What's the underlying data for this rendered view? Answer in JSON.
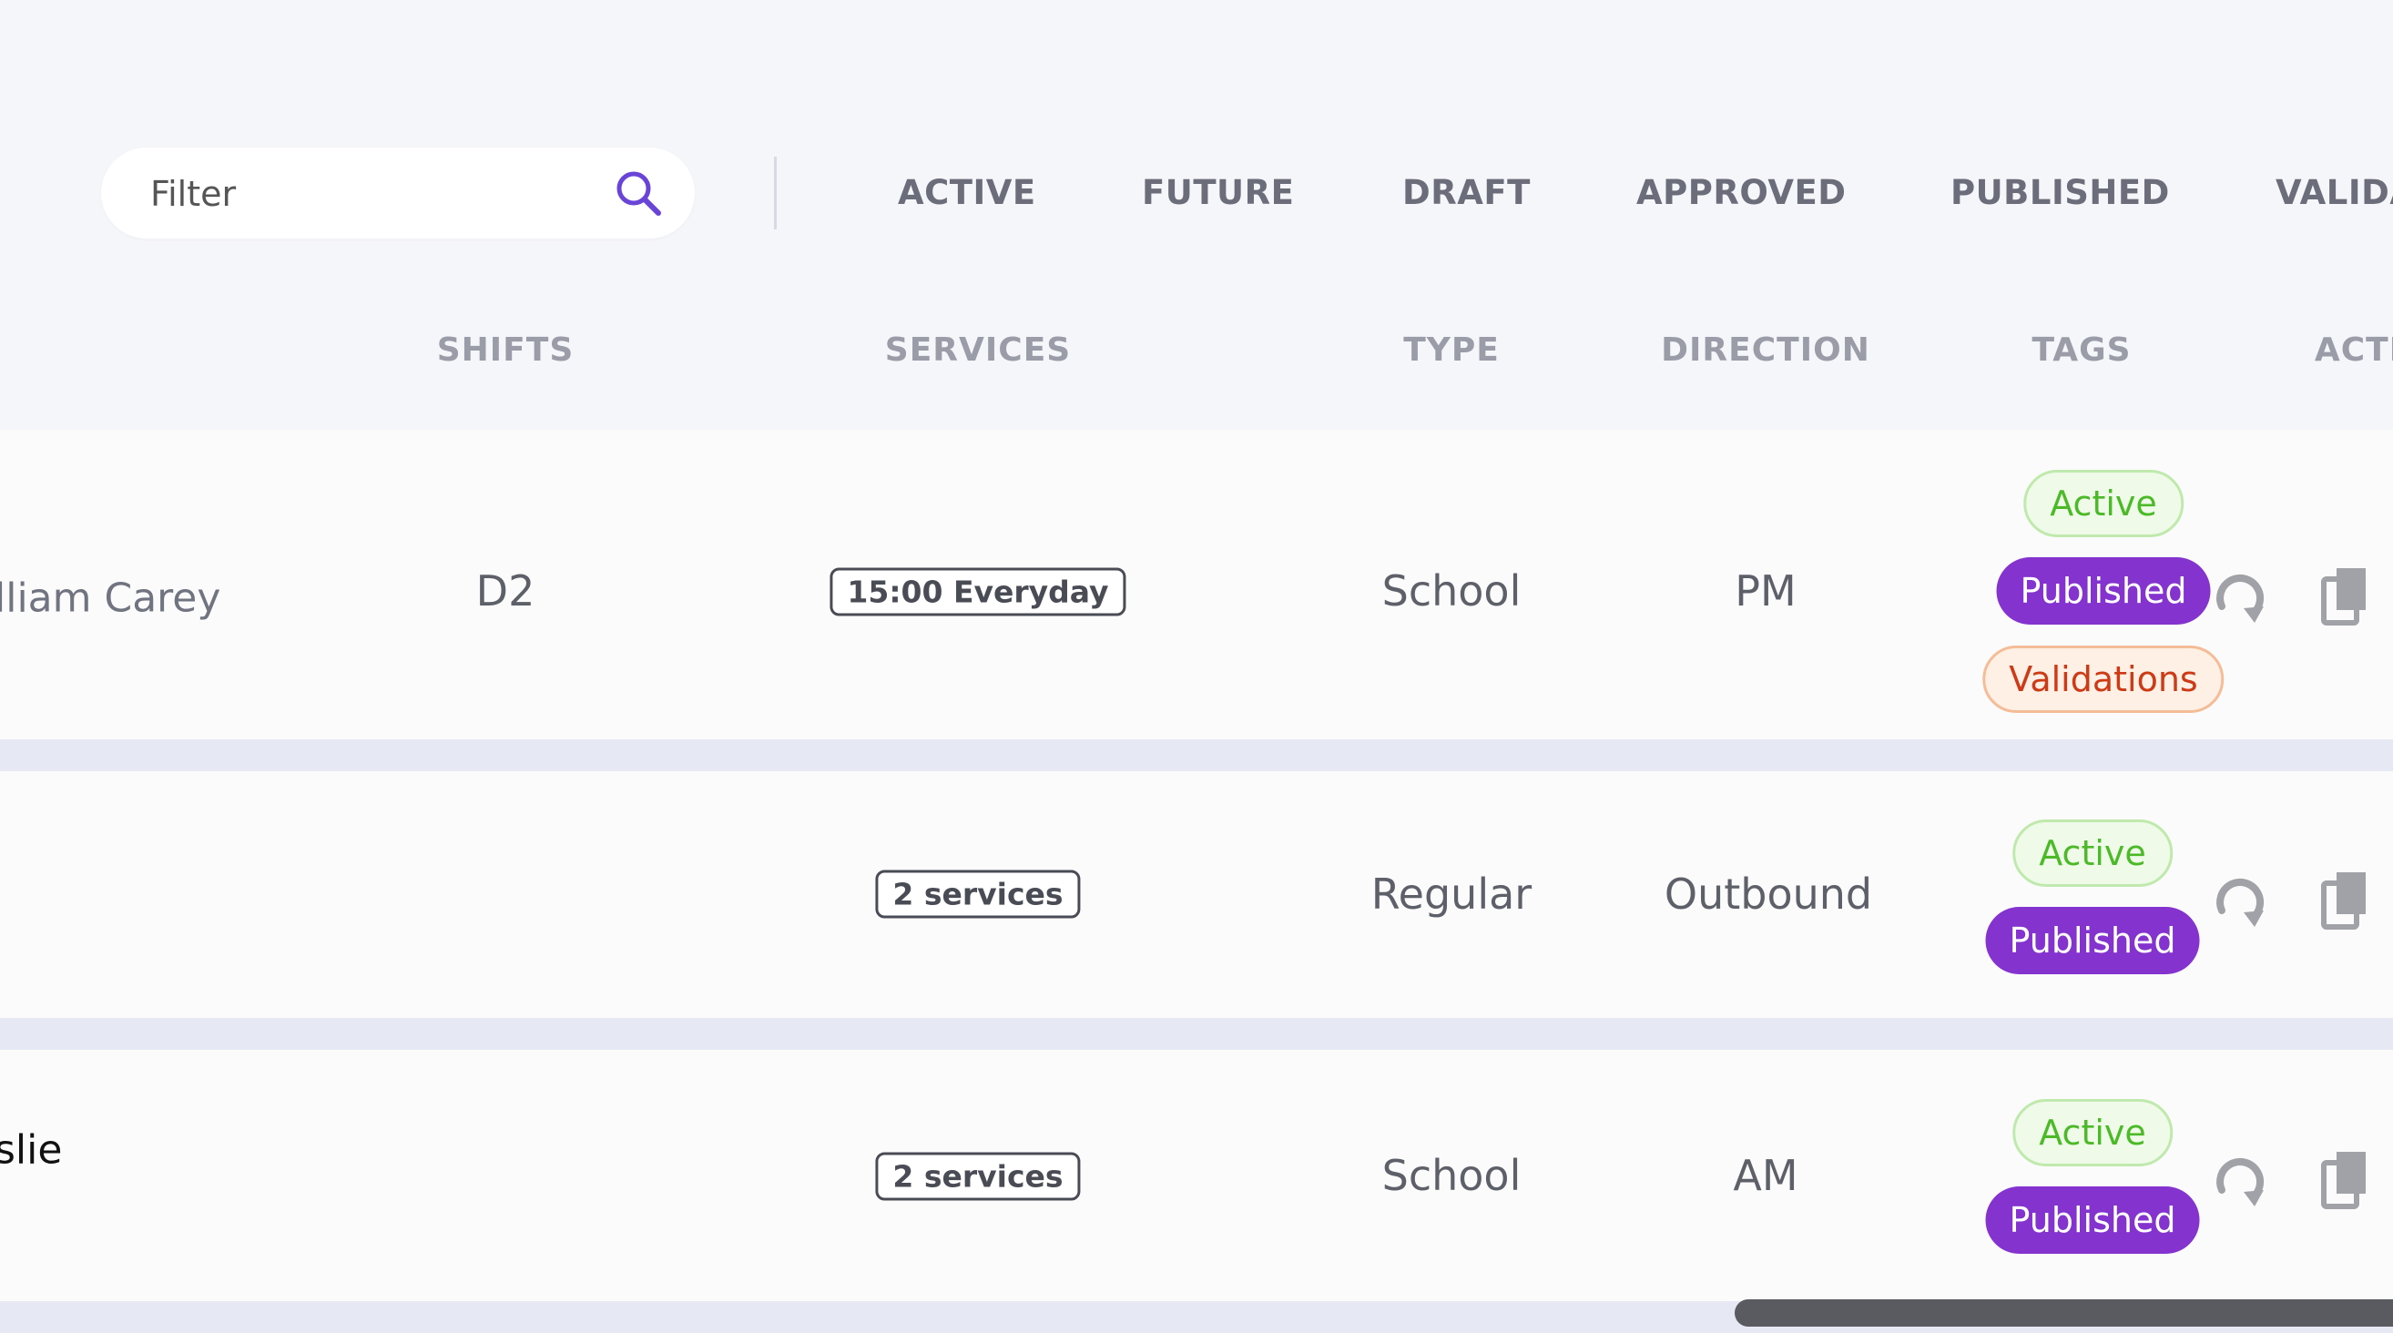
{
  "filter": {
    "placeholder": "Filter"
  },
  "status_tabs": [
    "ACTIVE",
    "FUTURE",
    "DRAFT",
    "APPROVED",
    "PUBLISHED",
    "VALIDA"
  ],
  "columns": [
    "SHIFTS",
    "SERVICES",
    "TYPE",
    "DIRECTION",
    "TAGS",
    "ACTI"
  ],
  "rows": [
    {
      "name": "lliam Carey",
      "shift": "D2",
      "services": "15:00 Everyday",
      "type": "School",
      "direction": "PM",
      "tags": [
        "Active",
        "Published",
        "Validations"
      ]
    },
    {
      "name": "",
      "shift": "",
      "services": "2 services",
      "type": "Regular",
      "direction": "Outbound",
      "tags": [
        "Active",
        "Published"
      ]
    },
    {
      "name": "slie",
      "shift": "",
      "services": "2 services",
      "type": "School",
      "direction": "AM",
      "tags": [
        "Active",
        "Published"
      ]
    }
  ],
  "colors": {
    "accent": "#8533cf",
    "active_tag": "#4cba28",
    "validations_tag": "#cc3a16",
    "search_icon": "#6a44d8"
  },
  "icons": {
    "search": "search-icon",
    "refresh": "refresh-icon",
    "copy": "copy-icon"
  }
}
